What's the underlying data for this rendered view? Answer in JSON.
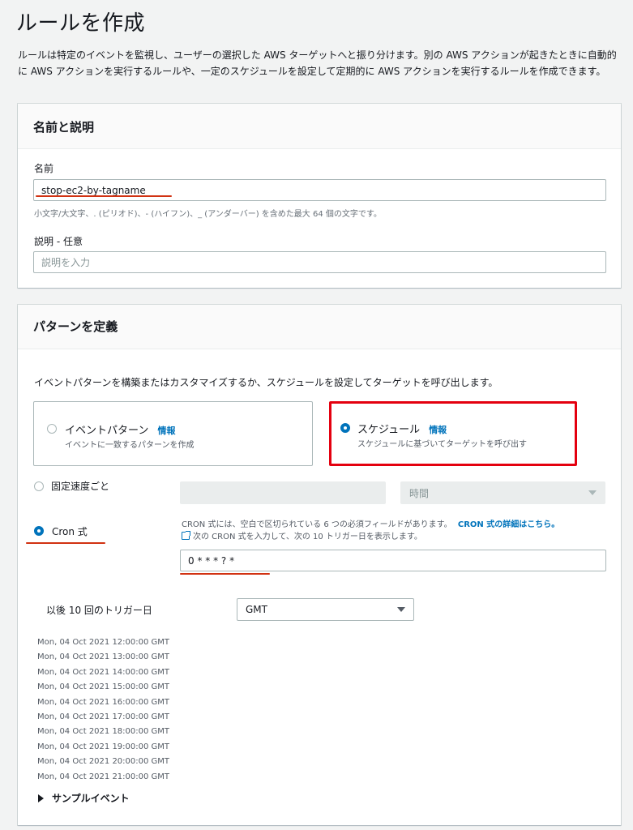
{
  "page": {
    "title": "ルールを作成",
    "description": "ルールは特定のイベントを監視し、ユーザーの選択した AWS ターゲットへと振り分けます。別の AWS アクションが起きたときに自動的に AWS アクションを実行するルールや、一定のスケジュールを設定して定期的に AWS アクションを実行するルールを作成できます。"
  },
  "name_section": {
    "title": "名前と説明",
    "name_label": "名前",
    "name_value": "stop-ec2-by-tagname",
    "name_hint": "小文字/大文字、. (ピリオド)、- (ハイフン)、_ (アンダーバー) を含めた最大 64 個の文字です。",
    "desc_label": "説明 - 任意",
    "desc_placeholder": "説明を入力"
  },
  "pattern_section": {
    "title": "パターンを定義",
    "intro": "イベントパターンを構築またはカスタマイズするか、スケジュールを設定してターゲットを呼び出します。",
    "event_pattern": {
      "title": "イベントパターン",
      "info": "情報",
      "subtitle": "イベントに一致するパターンを作成",
      "selected": false
    },
    "schedule": {
      "title": "スケジュール",
      "info": "情報",
      "subtitle": "スケジュールに基づいてターゲットを呼び出す",
      "selected": true
    },
    "fixed_rate": {
      "label": "固定速度ごと",
      "unit_placeholder": "時間",
      "selected": false
    },
    "cron": {
      "label": "Cron 式",
      "selected": true,
      "help_text": "CRON 式には、空白で区切られている 6 つの必須フィールドがあります。",
      "help_link": "CRON 式の詳細はこちら。",
      "help_text2": "次の CRON 式を入力して、次の 10 トリガー日を表示します。",
      "value": "0 * * * ? *"
    },
    "triggers": {
      "label": "以後 10 回のトリガー日",
      "timezone": "GMT",
      "dates": [
        "Mon, 04 Oct 2021 12:00:00 GMT",
        "Mon, 04 Oct 2021 13:00:00 GMT",
        "Mon, 04 Oct 2021 14:00:00 GMT",
        "Mon, 04 Oct 2021 15:00:00 GMT",
        "Mon, 04 Oct 2021 16:00:00 GMT",
        "Mon, 04 Oct 2021 17:00:00 GMT",
        "Mon, 04 Oct 2021 18:00:00 GMT",
        "Mon, 04 Oct 2021 19:00:00 GMT",
        "Mon, 04 Oct 2021 20:00:00 GMT",
        "Mon, 04 Oct 2021 21:00:00 GMT"
      ]
    },
    "sample_event": "サンプルイベント"
  },
  "colors": {
    "accent": "#0073bb",
    "annotation_red": "#e4000f"
  },
  "icons": [
    "radio-icon",
    "external-link-icon",
    "caret-down-icon",
    "expand-arrow-icon"
  ]
}
